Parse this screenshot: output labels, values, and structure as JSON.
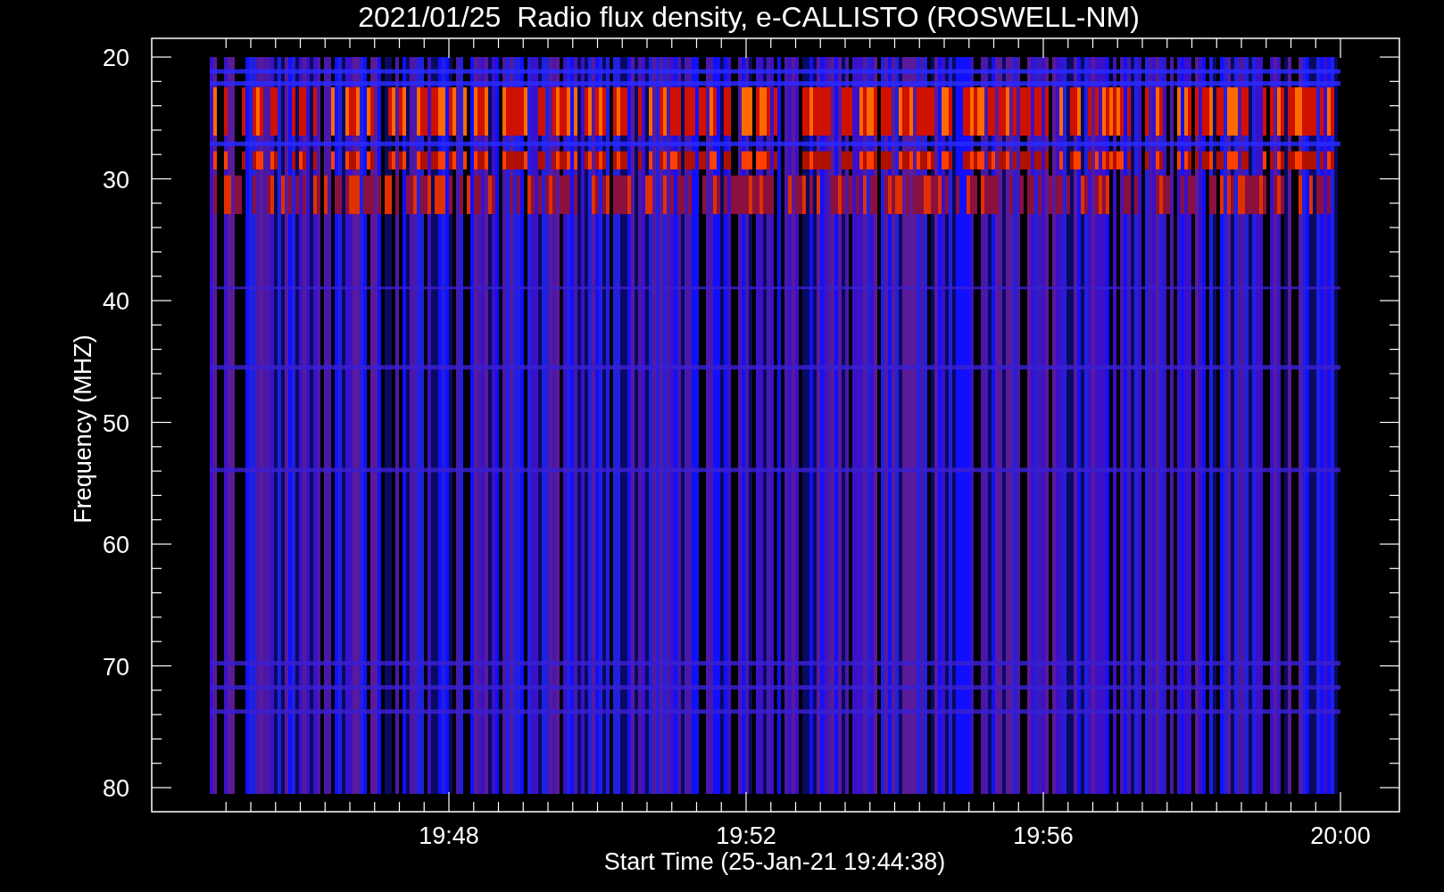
{
  "plot": {
    "title": "2021/01/25  Radio flux density, e-CALLISTO (ROSWELL-NM)",
    "y_axis": {
      "label": "Frequency (MHZ)",
      "ticks": [
        "20",
        "30",
        "40",
        "50",
        "60",
        "70",
        "80"
      ]
    },
    "x_axis": {
      "label": "Start Time (25-Jan-21 19:44:38)",
      "ticks": [
        "19:48",
        "19:52",
        "19:56",
        "20:00"
      ]
    }
  }
}
